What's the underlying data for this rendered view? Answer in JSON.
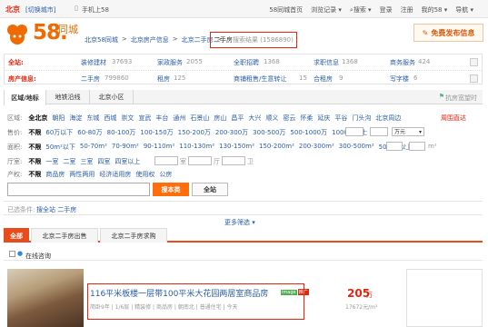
{
  "top": {
    "city": "北京",
    "switch_city": "[切换城市]",
    "mobile": "手机上58",
    "nav": [
      "58同城首页",
      "浏览记录",
      "搜索",
      "登录",
      "注册",
      "我的58",
      "导航"
    ]
  },
  "logo": {
    "text": "58.",
    "sub": "同城"
  },
  "breadcrumb": {
    "items": [
      "北京58同城",
      ">",
      "北京房产信息",
      ">",
      "北京二手房",
      ">"
    ],
    "current": "二手房",
    "result": "搜索结果 (1586890)"
  },
  "publish_btn": "免费发布信息",
  "cats": {
    "row1": [
      {
        "label": "全站:",
        "count": ""
      },
      {
        "label": "装修建材",
        "count": "37693"
      },
      {
        "label": "家政服务",
        "count": "2055"
      },
      {
        "label": "全职招聘",
        "count": "1368"
      },
      {
        "label": "求职信息",
        "count": "1368"
      },
      {
        "label": "商务服务",
        "count": "424"
      }
    ],
    "row2": [
      {
        "label": "房产信息:",
        "count": ""
      },
      {
        "label": "二手房",
        "count": "799860"
      },
      {
        "label": "租房",
        "count": "125"
      },
      {
        "label": "商铺租售/生意转让",
        "count": "15"
      },
      {
        "label": "合租房",
        "count": "9"
      },
      {
        "label": "写字楼",
        "count": "6"
      }
    ]
  },
  "tabs": [
    "区域/地标",
    "地铁沿线",
    "北京小区"
  ],
  "map_link": "抗房宽望时",
  "filters": {
    "area": {
      "label": "区域:",
      "selected": "全北京",
      "items": [
        "朝阳",
        "海淀",
        "东城",
        "西城",
        "崇文",
        "宣武",
        "丰台",
        "通州",
        "石景山",
        "房山",
        "昌平",
        "大兴",
        "顺义",
        "密云",
        "怀柔",
        "延庆",
        "平谷",
        "门头沟",
        "北京周边"
      ],
      "extra": "周围直达"
    },
    "price": {
      "label": "售价:",
      "selected": "不限",
      "items": [
        "60万以下",
        "60-80万",
        "80-100万",
        "100-150万",
        "150-200万",
        "200-300万",
        "300-500万",
        "500-1000万",
        "1000万以上"
      ],
      "unit": "万元"
    },
    "size": {
      "label": "面积:",
      "selected": "不限",
      "items": [
        "50m²以下",
        "50-70m²",
        "70-90m²",
        "90-110m²",
        "110-130m²",
        "130-150m²",
        "150-200m²",
        "200-300m²",
        "300-500m²",
        "500m²以上"
      ],
      "unit": "m²"
    },
    "rooms": {
      "label": "厅室:",
      "selected": "不限",
      "items": [
        "一室",
        "二室",
        "三室",
        "四室",
        "四室以上"
      ],
      "u1": "室",
      "u2": "厅",
      "u3": "卫"
    },
    "type": {
      "label": "产权:",
      "selected": "不限",
      "items": [
        "商品房",
        "两性两用",
        "经济适用房",
        "使用权",
        "公房"
      ]
    }
  },
  "search": {
    "btn1": "搜本类",
    "btn2": "全站"
  },
  "condition": {
    "label": "已选条件:",
    "value": "搜全站 二手房"
  },
  "more": "更多筛选",
  "result_tabs": [
    "全部",
    "北京二手房出售",
    "北京二手房求购"
  ],
  "online": "在线咨询",
  "listing": {
    "title": "116平米板楼一层带100平米大花园两居室商品房",
    "tag_img": "image",
    "tag_top": "推广",
    "meta": "简卧9年 | 1/6层 | 精装修 | 商品房 | 朝南北 | 普通住宅 | 今天",
    "price": "205",
    "price_unit": "万",
    "unit_price": "17672元/m²"
  },
  "colors": {
    "accent": "#ef6a00",
    "highlight": "#e3260e",
    "link": "#2b5ea8"
  }
}
